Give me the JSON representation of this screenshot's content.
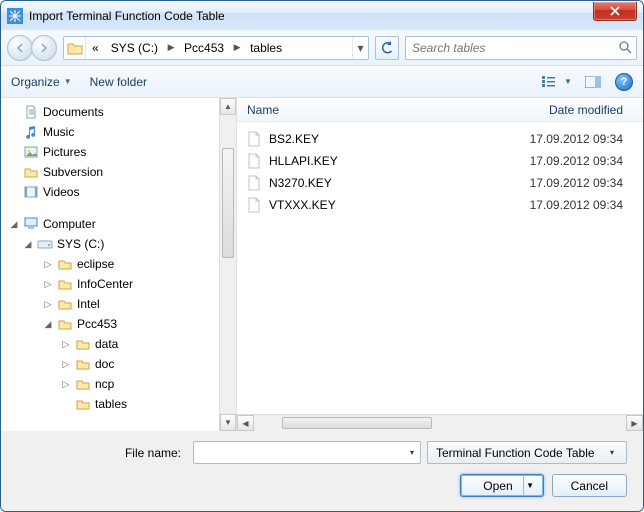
{
  "title": "Import Terminal Function Code Table",
  "breadcrumb": {
    "prefix": "«",
    "seg1": "SYS (C:)",
    "seg2": "Pcc453",
    "seg3": "tables"
  },
  "search": {
    "placeholder": "Search tables"
  },
  "toolbar": {
    "organize": "Organize",
    "newfolder": "New folder"
  },
  "columns": {
    "name": "Name",
    "date": "Date modified"
  },
  "files": [
    {
      "name": "BS2.KEY",
      "date": "17.09.2012 09:34"
    },
    {
      "name": "HLLAPI.KEY",
      "date": "17.09.2012 09:34"
    },
    {
      "name": "N3270.KEY",
      "date": "17.09.2012 09:34"
    },
    {
      "name": "VTXXX.KEY",
      "date": "17.09.2012 09:34"
    }
  ],
  "tree": {
    "libs": [
      "Documents",
      "Music",
      "Pictures",
      "Subversion",
      "Videos"
    ],
    "computer": "Computer",
    "drive": "SYS (C:)",
    "drivech": [
      "eclipse",
      "InfoCenter",
      "Intel",
      "Pcc453"
    ],
    "pccch": [
      "data",
      "doc",
      "ncp",
      "tables"
    ]
  },
  "footer": {
    "filenamelbl": "File name:",
    "filename": "",
    "filter": "Terminal Function Code Table",
    "open": "Open",
    "cancel": "Cancel"
  }
}
